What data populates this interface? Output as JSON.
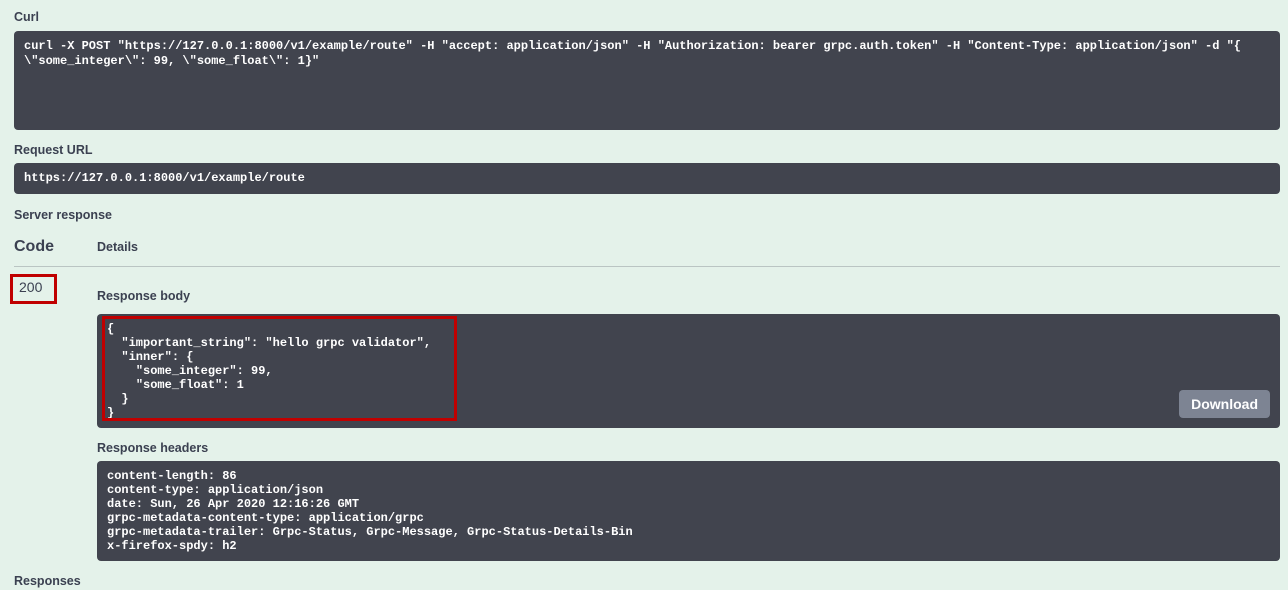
{
  "curl": {
    "label": "Curl",
    "command": "curl -X POST \"https://127.0.0.1:8000/v1/example/route\" -H \"accept: application/json\" -H \"Authorization: bearer grpc.auth.token\" -H \"Content-Type: application/json\" -d \"{ \\\"some_integer\\\": 99, \\\"some_float\\\": 1}\""
  },
  "request_url": {
    "label": "Request URL",
    "value": "https://127.0.0.1:8000/v1/example/route"
  },
  "server_response": {
    "label": "Server response",
    "code_header": "Code",
    "details_header": "Details",
    "status_code": "200"
  },
  "response_body": {
    "label": "Response body",
    "json": "{\n  \"important_string\": \"hello grpc validator\",\n  \"inner\": {\n    \"some_integer\": 99,\n    \"some_float\": 1\n  }\n}",
    "download_label": "Download"
  },
  "response_headers": {
    "label": "Response headers",
    "text": "content-length: 86\ncontent-type: application/json\ndate: Sun, 26 Apr 2020 12:16:26 GMT\ngrpc-metadata-content-type: application/grpc\ngrpc-metadata-trailer: Grpc-Status, Grpc-Message, Grpc-Status-Details-Bin\nx-firefox-spdy: h2"
  },
  "responses": {
    "label": "Responses"
  },
  "colors": {
    "panel_bg": "#e4f2ea",
    "code_block_bg": "#41444e",
    "label_text": "#3b4151",
    "code_text": "#ffffff",
    "annotation_red": "#c00000",
    "download_button_bg": "#7d8493"
  }
}
